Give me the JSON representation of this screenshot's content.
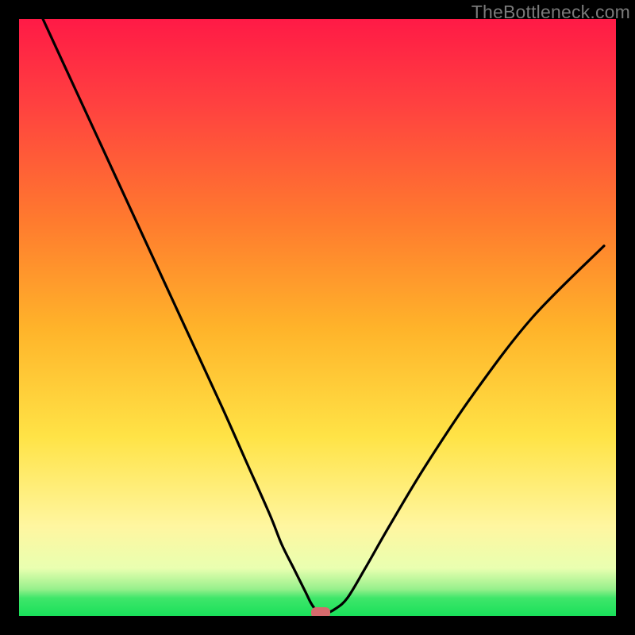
{
  "watermark": "TheBottleneck.com",
  "chart_data": {
    "type": "line",
    "title": "",
    "xlabel": "",
    "ylabel": "",
    "xlim": [
      0,
      100
    ],
    "ylim": [
      0,
      100
    ],
    "grid": false,
    "background_gradient": {
      "direction": "vertical",
      "stops": [
        {
          "pos": 0,
          "color": "#ff1a46"
        },
        {
          "pos": 0.14,
          "color": "#ff4040"
        },
        {
          "pos": 0.34,
          "color": "#ff7b2e"
        },
        {
          "pos": 0.52,
          "color": "#ffb42a"
        },
        {
          "pos": 0.7,
          "color": "#ffe346"
        },
        {
          "pos": 0.85,
          "color": "#fff6a0"
        },
        {
          "pos": 0.92,
          "color": "#e9ffb0"
        },
        {
          "pos": 0.955,
          "color": "#97f08c"
        },
        {
          "pos": 0.97,
          "color": "#3fe66a"
        },
        {
          "pos": 1.0,
          "color": "#19e05a"
        }
      ]
    },
    "series": [
      {
        "name": "bottleneck-curve",
        "color": "#000000",
        "x": [
          4,
          10,
          16,
          22,
          28,
          34,
          38,
          42,
          44,
          46,
          48,
          49,
          50,
          51.5,
          53,
          55,
          58,
          62,
          68,
          76,
          86,
          98
        ],
        "y": [
          100,
          87,
          74,
          61,
          48,
          35,
          26,
          17,
          12,
          8,
          4,
          2,
          0.8,
          0.5,
          1.2,
          3,
          8,
          15,
          25,
          37,
          50,
          62
        ]
      }
    ],
    "marker": {
      "name": "optimum-point",
      "x": 50.5,
      "y": 0.5,
      "color": "#d76a6d"
    }
  }
}
